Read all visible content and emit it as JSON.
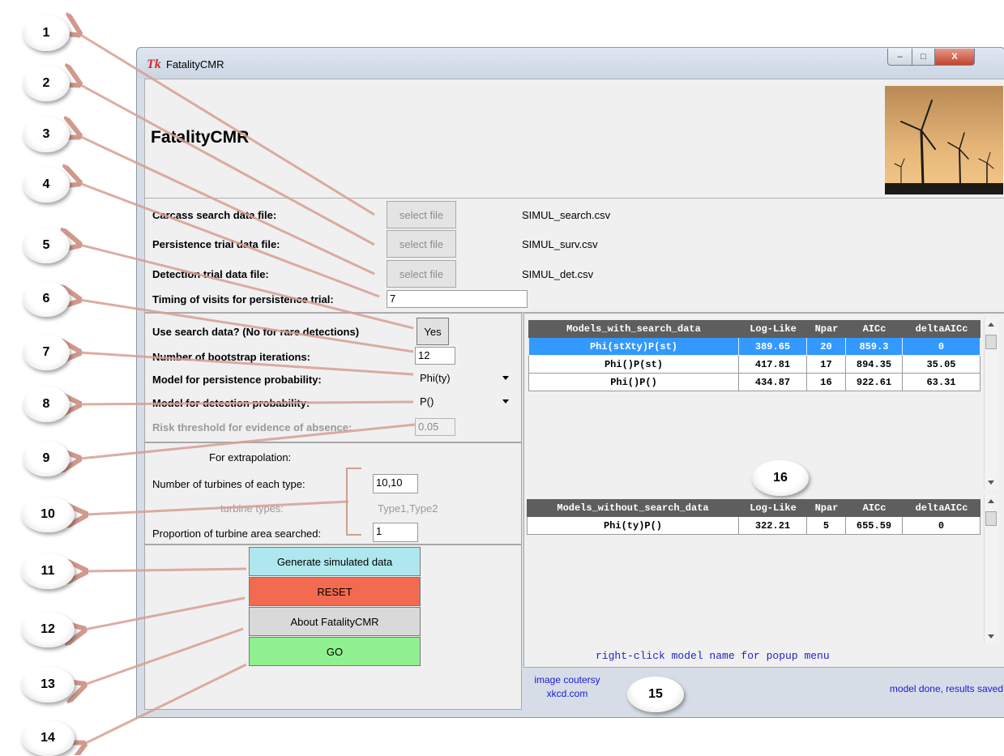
{
  "window": {
    "title": "FatalityCMR",
    "logo": "Tk"
  },
  "header": {
    "title": "FatalityCMR",
    "image": "wind-turbines-photo"
  },
  "files": [
    {
      "label": "Carcass search data file:",
      "button": "select file",
      "filename": "SIMUL_search.csv"
    },
    {
      "label": "Persistence trial data file:",
      "button": "select file",
      "filename": "SIMUL_surv.csv"
    },
    {
      "label": "Detection trial data file:",
      "button": "select file",
      "filename": "SIMUL_det.csv"
    }
  ],
  "timing": {
    "label": "Timing of visits for persistence trial:",
    "value": "7"
  },
  "options": {
    "use_search_label": "Use search data? (No for rare detections)",
    "use_search_button": "Yes",
    "bootstrap_label": "Number of bootstrap iterations:",
    "bootstrap_value": "12",
    "persistence_label": "Model for persistence probability:",
    "persistence_value": "Phi(ty)",
    "detection_label": "Model for detection probability:",
    "detection_value": "P()",
    "risk_label": "Risk threshold for evidence of absence:",
    "risk_value": "0.05"
  },
  "extrapolation": {
    "heading": "For extrapolation:",
    "turbines_label": "Number of turbines of each type:",
    "turbines_value": "10,10",
    "types_label": "turbine types:",
    "types_value": "Type1,Type2",
    "proportion_label": "Proportion of turbine area searched:",
    "proportion_value": "1"
  },
  "buttons": {
    "generate": "Generate simulated data",
    "reset": "RESET",
    "about": "About FatalityCMR",
    "go": "GO"
  },
  "colors": {
    "generate": "#aee8ee",
    "reset": "#f26a4f",
    "about": "#d9d9d9",
    "go": "#8ff08f",
    "table_header": "#5e5e5e",
    "selected_row": "#3399ff"
  },
  "table_with": {
    "headers": [
      "Models_with_search_data",
      "Log-Like",
      "Npar",
      "AICc",
      "deltaAICc"
    ],
    "rows": [
      [
        "Phi(stXty)P(st)",
        "389.65",
        "20",
        "859.3",
        "0"
      ],
      [
        "Phi()P(st)",
        "417.81",
        "17",
        "894.35",
        "35.05"
      ],
      [
        "Phi()P()",
        "434.87",
        "16",
        "922.61",
        "63.31"
      ]
    ]
  },
  "table_without": {
    "headers": [
      "Models_without_search_data",
      "Log-Like",
      "Npar",
      "AICc",
      "deltaAICc"
    ],
    "rows": [
      [
        "Phi(ty)P()",
        "322.21",
        "5",
        "655.59",
        "0"
      ]
    ]
  },
  "hint": "right-click model name for popup menu",
  "credit": {
    "line1": "image coutersy",
    "line2": "xkcd.com"
  },
  "status": "model done, results saved",
  "callouts": [
    "1",
    "2",
    "3",
    "4",
    "5",
    "6",
    "7",
    "8",
    "9",
    "10",
    "11",
    "12",
    "13",
    "14",
    "15",
    "16"
  ]
}
